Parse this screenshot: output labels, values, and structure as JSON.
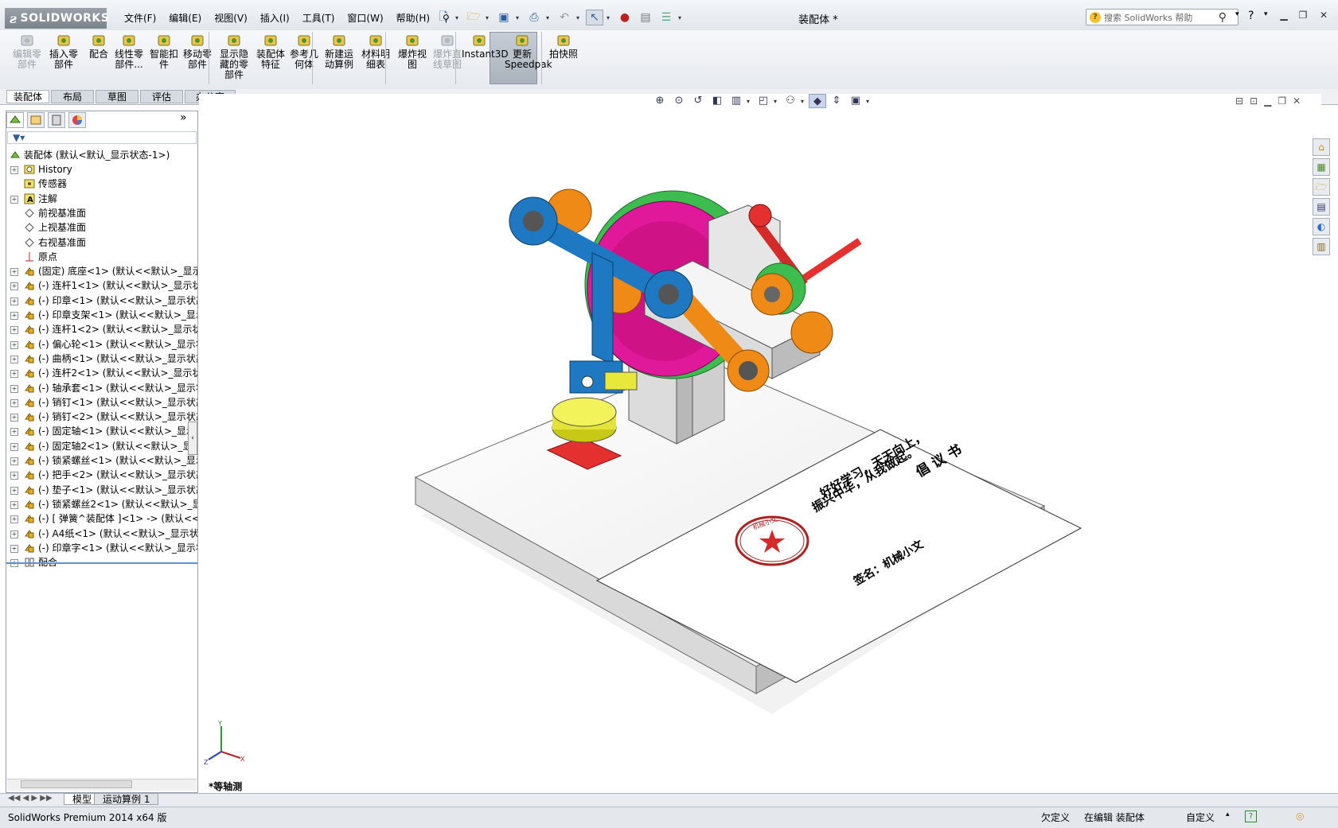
{
  "app": {
    "logo": "SOLIDWORKS",
    "document_title": "装配体 *"
  },
  "menu": [
    "文件(F)",
    "编辑(E)",
    "视图(V)",
    "插入(I)",
    "工具(T)",
    "窗口(W)",
    "帮助(H)"
  ],
  "search": {
    "placeholder": "搜索 SolidWorks 帮助"
  },
  "commands": [
    {
      "label": "编辑零\n部件",
      "icon": "edit-component-icon",
      "disabled": true
    },
    {
      "label": "插入零\n部件",
      "icon": "insert-component-icon",
      "disabled": false
    },
    {
      "label": "配合",
      "icon": "mate-icon",
      "disabled": false
    },
    {
      "label": "线性零\n部件...",
      "icon": "linear-pattern-icon",
      "disabled": false
    },
    {
      "label": "智能扣\n件",
      "icon": "smart-fasteners-icon",
      "disabled": false
    },
    {
      "label": "移动零\n部件",
      "icon": "move-component-icon",
      "disabled": false
    },
    {
      "label": "显示隐\n藏的零\n部件",
      "icon": "show-hidden-icon",
      "disabled": false
    },
    {
      "label": "装配体\n特征",
      "icon": "assembly-feature-icon",
      "disabled": false
    },
    {
      "label": "参考几\n何体",
      "icon": "reference-geometry-icon",
      "disabled": false
    },
    {
      "label": "新建运\n动算例",
      "icon": "motion-study-icon",
      "disabled": false
    },
    {
      "label": "材料明\n细表",
      "icon": "bom-icon",
      "disabled": false
    },
    {
      "label": "爆炸视\n图",
      "icon": "exploded-view-icon",
      "disabled": false
    },
    {
      "label": "爆炸直\n线草图",
      "icon": "explode-line-icon",
      "disabled": true
    },
    {
      "label": "Instant3D",
      "icon": "instant3d-icon",
      "disabled": false
    },
    {
      "label": "更新\nSpeedpak",
      "icon": "speedpak-icon",
      "disabled": false
    },
    {
      "label": "拍快照",
      "icon": "snapshot-icon",
      "disabled": false
    }
  ],
  "tabs": [
    "装配体",
    "布局",
    "草图",
    "评估",
    "办公室产品"
  ],
  "tree": {
    "root": "装配体 (默认<默认_显示状态-1>)",
    "items": [
      {
        "label": "History",
        "icon": "history-icon",
        "expand": true
      },
      {
        "label": "传感器",
        "icon": "sensor-icon",
        "expand": false
      },
      {
        "label": "注解",
        "icon": "annotation-icon",
        "expand": true
      },
      {
        "label": "前视基准面",
        "icon": "plane-icon",
        "expand": false
      },
      {
        "label": "上视基准面",
        "icon": "plane-icon",
        "expand": false
      },
      {
        "label": "右视基准面",
        "icon": "plane-icon",
        "expand": false
      },
      {
        "label": "原点",
        "icon": "origin-icon",
        "expand": false
      },
      {
        "label": "(固定) 底座<1> (默认<<默认>_显示",
        "icon": "part-icon",
        "expand": true
      },
      {
        "label": "(-) 连杆1<1> (默认<<默认>_显示状",
        "icon": "part-icon",
        "expand": true
      },
      {
        "label": "(-) 印章<1> (默认<<默认>_显示状态",
        "icon": "part-icon",
        "expand": true
      },
      {
        "label": "(-) 印章支架<1> (默认<<默认>_显示",
        "icon": "part-icon",
        "expand": true
      },
      {
        "label": "(-) 连杆1<2> (默认<<默认>_显示状",
        "icon": "part-icon",
        "expand": true
      },
      {
        "label": "(-) 偏心轮<1> (默认<<默认>_显示状",
        "icon": "part-icon",
        "expand": true
      },
      {
        "label": "(-) 曲柄<1> (默认<<默认>_显示状态",
        "icon": "part-icon",
        "expand": true
      },
      {
        "label": "(-) 连杆2<1> (默认<<默认>_显示状",
        "icon": "part-icon",
        "expand": true
      },
      {
        "label": "(-) 轴承套<1> (默认<<默认>_显示状",
        "icon": "part-icon",
        "expand": true
      },
      {
        "label": "(-) 销钉<1> (默认<<默认>_显示状态",
        "icon": "part-icon",
        "expand": true
      },
      {
        "label": "(-) 销钉<2> (默认<<默认>_显示状态",
        "icon": "part-icon",
        "expand": true
      },
      {
        "label": "(-) 固定轴<1> (默认<<默认>_显示状",
        "icon": "part-icon",
        "expand": true
      },
      {
        "label": "(-) 固定轴2<1> (默认<<默认>_显示",
        "icon": "part-icon",
        "expand": true
      },
      {
        "label": "(-) 锁紧螺丝<1> (默认<<默认>_显示",
        "icon": "part-icon",
        "expand": true
      },
      {
        "label": "(-) 把手<2> (默认<<默认>_显示状态",
        "icon": "part-icon",
        "expand": true
      },
      {
        "label": "(-) 垫子<1> (默认<<默认>_显示状态",
        "icon": "part-icon",
        "expand": true
      },
      {
        "label": "(-) 锁紧螺丝2<1> (默认<<默认>_显",
        "icon": "part-icon",
        "expand": true
      },
      {
        "label": "(-) [ 弹簧^装配体 ]<1> -> (默认<<",
        "icon": "part-icon",
        "expand": true
      },
      {
        "label": "(-) A4纸<1> (默认<<默认>_显示状态",
        "icon": "part-icon",
        "expand": true
      },
      {
        "label": "(-) 印章字<1> (默认<<默认>_显示状",
        "icon": "part-icon",
        "expand": true
      },
      {
        "label": "配合",
        "icon": "mates-icon",
        "expand": true
      }
    ]
  },
  "model": {
    "paper_title": "倡 议 书",
    "paper_line1": "好好学习，天天向上，",
    "paper_line2": "振兴中华，从我做起。",
    "paper_signature": "签名：机械小文",
    "stamp_text": "机械小文"
  },
  "view": {
    "name": "*等轴测",
    "triad_x": "X",
    "triad_y": "Y",
    "triad_z": "Z"
  },
  "bottom_tabs": [
    "模型",
    "运动算例 1"
  ],
  "status": {
    "product": "SolidWorks Premium 2014 x64 版",
    "underdefined": "欠定义",
    "editing": "在编辑 装配体",
    "custom": "自定义",
    "help": "?"
  },
  "colors": {
    "orange": "#ef8a16",
    "blue": "#1e78c2",
    "green": "#3dbd4f",
    "magenta": "#e0199a",
    "red": "#e53030",
    "yellow": "#e8e83a",
    "stamp_red": "#b02020"
  }
}
